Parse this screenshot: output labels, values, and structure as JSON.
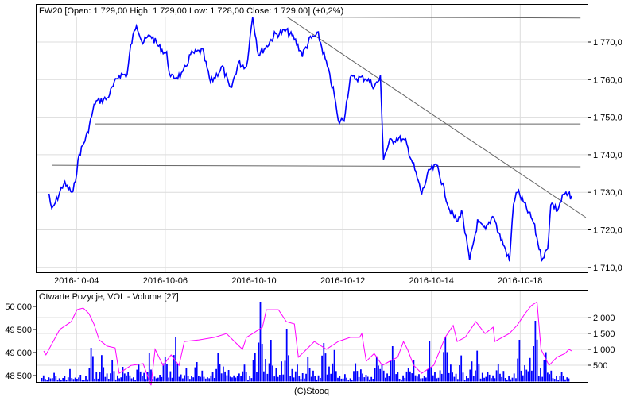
{
  "chart_data": [
    {
      "type": "line",
      "title": "FW20 [Open: 1 729,00  High: 1 729,00  Low: 1 728,00  Close: 1 729,00] (+0,2%)",
      "x_unit": "trading day index (0 = 2016-10-03)",
      "x_ticks": [
        {
          "day": 1,
          "label": "2016-10-04"
        },
        {
          "day": 3,
          "label": "2016-10-06"
        },
        {
          "day": 5,
          "label": "2016-10-10"
        },
        {
          "day": 7,
          "label": "2016-10-12"
        },
        {
          "day": 9,
          "label": "2016-10-14"
        },
        {
          "day": 11,
          "label": "2016-10-18"
        }
      ],
      "y_ticks": [
        {
          "value": 1770,
          "label": "1 770,0"
        },
        {
          "value": 1760,
          "label": "1 760,0"
        },
        {
          "value": 1750,
          "label": "1 750,0"
        },
        {
          "value": 1740,
          "label": "1 740,0"
        },
        {
          "value": 1730,
          "label": "1 730,0"
        },
        {
          "value": 1720,
          "label": "1 720,0"
        },
        {
          "value": 1710,
          "label": "1 710,0"
        }
      ],
      "ylim": [
        1708,
        1781
      ],
      "xlim": [
        0.08,
        12.36
      ],
      "grid": true,
      "series": [
        {
          "name": "FW20",
          "color": "#0000ff",
          "points": [
            [
              0.38,
              1729.6
            ],
            [
              0.44,
              1725
            ],
            [
              0.71,
              1732.4
            ],
            [
              0.92,
              1729.6
            ],
            [
              1.06,
              1740
            ],
            [
              1.24,
              1745.5
            ],
            [
              1.42,
              1754
            ],
            [
              1.69,
              1755
            ],
            [
              1.96,
              1761.3
            ],
            [
              2.14,
              1761.3
            ],
            [
              2.22,
              1768.8
            ],
            [
              2.35,
              1775
            ],
            [
              2.49,
              1769.8
            ],
            [
              2.67,
              1771.9
            ],
            [
              2.85,
              1768.8
            ],
            [
              3.03,
              1766.7
            ],
            [
              3.12,
              1760.4
            ],
            [
              3.39,
              1761.3
            ],
            [
              3.57,
              1766.7
            ],
            [
              3.84,
              1767.7
            ],
            [
              4.02,
              1759.2
            ],
            [
              4.29,
              1763.4
            ],
            [
              4.47,
              1757.1
            ],
            [
              4.65,
              1764.4
            ],
            [
              4.83,
              1763.4
            ],
            [
              4.97,
              1777
            ],
            [
              5.1,
              1766.7
            ],
            [
              5.28,
              1768.8
            ],
            [
              5.46,
              1771.9
            ],
            [
              5.73,
              1773
            ],
            [
              5.91,
              1770.9
            ],
            [
              6.09,
              1766.7
            ],
            [
              6.27,
              1770.9
            ],
            [
              6.45,
              1771.9
            ],
            [
              6.63,
              1764.4
            ],
            [
              6.81,
              1756
            ],
            [
              6.9,
              1748.6
            ],
            [
              7.03,
              1749.7
            ],
            [
              7.17,
              1760.4
            ],
            [
              7.53,
              1760.4
            ],
            [
              7.71,
              1758.2
            ],
            [
              7.85,
              1760.4
            ],
            [
              7.92,
              1739.2
            ],
            [
              8.06,
              1743.4
            ],
            [
              8.24,
              1744.5
            ],
            [
              8.42,
              1743.4
            ],
            [
              8.6,
              1737
            ],
            [
              8.78,
              1729.6
            ],
            [
              8.96,
              1736
            ],
            [
              9.14,
              1737
            ],
            [
              9.23,
              1732.8
            ],
            [
              9.41,
              1725.4
            ],
            [
              9.59,
              1722
            ],
            [
              9.68,
              1725.4
            ],
            [
              9.86,
              1711.6
            ],
            [
              10.04,
              1722
            ],
            [
              10.22,
              1719.9
            ],
            [
              10.4,
              1724.2
            ],
            [
              10.49,
              1719.9
            ],
            [
              10.67,
              1714.7
            ],
            [
              10.76,
              1711.6
            ],
            [
              10.85,
              1727.3
            ],
            [
              10.94,
              1730.4
            ],
            [
              11.12,
              1726.2
            ],
            [
              11.3,
              1722
            ],
            [
              11.48,
              1712.5
            ],
            [
              11.62,
              1714.7
            ],
            [
              11.69,
              1727.3
            ],
            [
              11.84,
              1725.2
            ],
            [
              11.98,
              1729.4
            ],
            [
              12.16,
              1729
            ]
          ]
        }
      ],
      "annotations": {
        "lines": [
          {
            "from": [
              1.89,
              1776.8
            ],
            "to": [
              12.36,
              1776.4
            ]
          },
          {
            "from": [
              1.42,
              1748.2
            ],
            "to": [
              12.36,
              1748.2
            ]
          },
          {
            "from": [
              0.44,
              1737.2
            ],
            "to": [
              12.36,
              1736.8
            ]
          },
          {
            "from": [
              5.73,
              1776.8
            ],
            "to": [
              12.48,
              1723.3
            ]
          }
        ]
      }
    },
    {
      "type": "bar+line",
      "title": "Otwarte Pozycje, VOL - Volume [27]",
      "left_axis": {
        "name": "Otwarte Pozycje",
        "ylim": [
          48380,
          50200
        ],
        "ticks": [
          {
            "value": 50000,
            "label": "50 000"
          },
          {
            "value": 49500,
            "label": "49 500"
          },
          {
            "value": 49000,
            "label": "49 000"
          },
          {
            "value": 48500,
            "label": "48 500"
          }
        ]
      },
      "right_axis": {
        "name": "Volume",
        "ylim": [
          0,
          2650
        ],
        "ticks": [
          {
            "value": 2000,
            "label": "2 000"
          },
          {
            "value": 1500,
            "label": "1 500"
          },
          {
            "value": 1000,
            "label": "1 000"
          },
          {
            "value": 500,
            "label": "500"
          }
        ]
      },
      "series": [
        {
          "name": "Otwarte Pozycje",
          "color": "#ff00ff",
          "points": [
            [
              0.26,
              49035
            ],
            [
              0.31,
              48950
            ],
            [
              0.62,
              49500
            ],
            [
              0.88,
              49670
            ],
            [
              1.01,
              49930
            ],
            [
              1.15,
              49965
            ],
            [
              1.28,
              49845
            ],
            [
              1.39,
              49620
            ],
            [
              1.51,
              49275
            ],
            [
              1.69,
              49140
            ],
            [
              1.87,
              49100
            ],
            [
              1.96,
              48550
            ],
            [
              2.23,
              48720
            ],
            [
              2.5,
              48760
            ],
            [
              2.68,
              48290
            ],
            [
              2.77,
              49070
            ],
            [
              2.95,
              48720
            ],
            [
              3.13,
              48950
            ],
            [
              3.31,
              48720
            ],
            [
              3.43,
              49240
            ],
            [
              3.76,
              49275
            ],
            [
              4.11,
              49330
            ],
            [
              4.38,
              49410
            ],
            [
              4.56,
              49240
            ],
            [
              4.74,
              49070
            ],
            [
              4.83,
              49330
            ],
            [
              4.97,
              49410
            ],
            [
              5.19,
              49550
            ],
            [
              5.28,
              49930
            ],
            [
              5.55,
              49930
            ],
            [
              5.73,
              49670
            ],
            [
              5.91,
              49620
            ],
            [
              6.0,
              48900
            ],
            [
              6.09,
              48980
            ],
            [
              6.36,
              49240
            ],
            [
              6.63,
              49070
            ],
            [
              6.9,
              49240
            ],
            [
              7.17,
              49330
            ],
            [
              7.38,
              49330
            ],
            [
              7.43,
              49410
            ],
            [
              7.53,
              48810
            ],
            [
              7.71,
              48980
            ],
            [
              7.89,
              48720
            ],
            [
              8.06,
              48810
            ],
            [
              8.24,
              48900
            ],
            [
              8.37,
              49240
            ],
            [
              8.46,
              49070
            ],
            [
              8.6,
              48720
            ],
            [
              8.78,
              48550
            ],
            [
              9.05,
              48720
            ],
            [
              9.31,
              49330
            ],
            [
              9.49,
              49590
            ],
            [
              9.58,
              49240
            ],
            [
              9.76,
              49330
            ],
            [
              10.0,
              49670
            ],
            [
              10.21,
              49410
            ],
            [
              10.39,
              49550
            ],
            [
              10.43,
              49240
            ],
            [
              10.75,
              49410
            ],
            [
              10.93,
              49590
            ],
            [
              11.11,
              49845
            ],
            [
              11.25,
              50017
            ],
            [
              11.38,
              50100
            ],
            [
              11.47,
              49070
            ],
            [
              11.65,
              48720
            ],
            [
              11.83,
              48900
            ],
            [
              12.01,
              48980
            ],
            [
              12.1,
              49070
            ],
            [
              12.16,
              49035
            ]
          ]
        },
        {
          "name": "Volume",
          "color": "#0000ff",
          "values": [
            180,
            120,
            260,
            90,
            150,
            380,
            110,
            200,
            160,
            1050,
            300,
            820,
            240,
            650,
            180,
            450,
            300,
            120,
            520,
            260,
            880,
            140,
            200,
            760,
            310,
            1400,
            210,
            420,
            170,
            600,
            330,
            120,
            280,
            900,
            460,
            350,
            180,
            240,
            520,
            150,
            900,
            2500,
            700,
            1300,
            400,
            620,
            1650,
            380,
            520,
            250,
            770,
            330,
            180,
            1200,
            460,
            980,
            150,
            220,
            90,
            560,
            370,
            200,
            130,
            780,
            540,
            240,
            1100,
            300,
            180,
            410,
            650,
            220,
            160,
            1250,
            280,
            340,
            1400,
            520,
            230,
            810,
            150,
            620,
            960,
            260,
            290,
            180,
            540,
            320,
            170,
            240,
            1300,
            500,
            730,
            1900,
            420,
            910,
            330,
            160,
            280,
            120
          ]
        }
      ],
      "volume_xlim": [
        0.2,
        12.12
      ]
    }
  ],
  "footer": {
    "credit": "(C)Stooq"
  }
}
